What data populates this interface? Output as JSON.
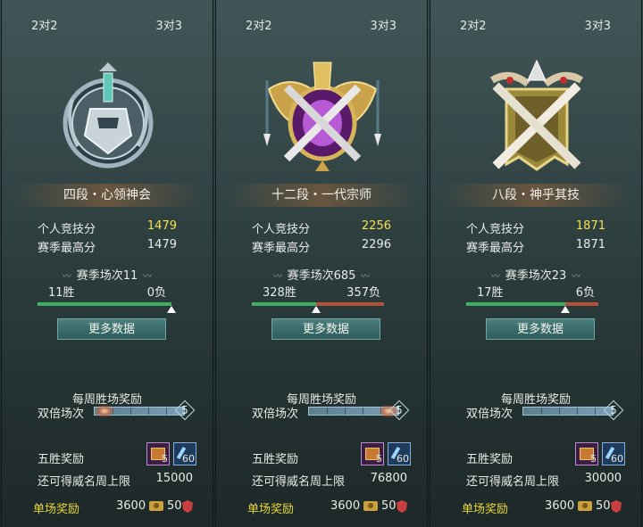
{
  "panels": [
    {
      "tab_2v2": "2对2",
      "tab_3v3": "3对3",
      "emblem": "rank-emblem-silver-helmet",
      "rank_name": "四段・心领神会",
      "personal_score_label": "个人竞技分",
      "personal_score": "1479",
      "season_best_label": "赛季最高分",
      "season_best": "1479",
      "season_matches": "赛季场次11",
      "wins": "11胜",
      "losses": "0负",
      "win_fraction": 1.0,
      "more_data": "更多数据",
      "weekly_reward_title": "每周胜场奖励",
      "double_label": "双倍场次",
      "double_count": "5",
      "double_glow_fraction": 0.1,
      "five_win_label": "五胜奖励",
      "chest_count": "5",
      "item_count": "60",
      "prestige_label": "还可得威名周上限",
      "prestige_value": "15000",
      "single_label": "单场奖励",
      "single_gold": "3600",
      "single_honor": "50"
    },
    {
      "tab_2v2": "2对2",
      "tab_3v3": "3对3",
      "emblem": "rank-emblem-golden-winged-crest",
      "rank_name": "十二段・一代宗师",
      "personal_score_label": "个人竞技分",
      "personal_score": "2256",
      "season_best_label": "赛季最高分",
      "season_best": "2296",
      "season_matches": "赛季场次685",
      "wins": "328胜",
      "losses": "357负",
      "win_fraction": 0.479,
      "more_data": "更多数据",
      "weekly_reward_title": "每周胜场奖励",
      "double_label": "双倍场次",
      "double_count": "5",
      "double_glow_fraction": 0.95,
      "five_win_label": "五胜奖励",
      "chest_count": "5",
      "item_count": "60",
      "prestige_label": "还可得威名周上限",
      "prestige_value": "76800",
      "single_label": "单场奖励",
      "single_gold": "3600",
      "single_honor": "50"
    },
    {
      "tab_2v2": "2对2",
      "tab_3v3": "3对3",
      "emblem": "rank-emblem-crossed-swords-banner",
      "rank_name": "八段・神乎其技",
      "personal_score_label": "个人竞技分",
      "personal_score": "1871",
      "season_best_label": "赛季最高分",
      "season_best": "1871",
      "season_matches": "赛季场次23",
      "wins": "17胜",
      "losses": "6负",
      "win_fraction": 0.739,
      "more_data": "更多数据",
      "weekly_reward_title": "每周胜场奖励",
      "double_label": "双倍场次",
      "double_count": "5",
      "double_glow_fraction": 0,
      "five_win_label": "五胜奖励",
      "chest_count": "5",
      "item_count": "60",
      "prestige_label": "还可得威名周上限",
      "prestige_value": "30000",
      "single_label": "单场奖励",
      "single_gold": "3600",
      "single_honor": "50"
    }
  ]
}
